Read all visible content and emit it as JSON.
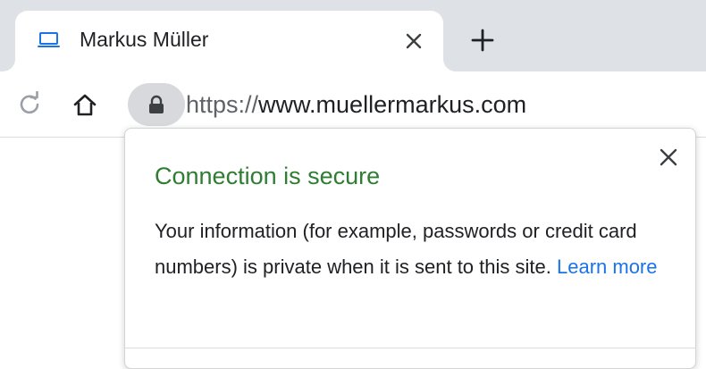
{
  "tab": {
    "title": "Markus Müller",
    "favicon": "laptop-icon",
    "close_icon": "close-icon"
  },
  "new_tab_icon": "plus-icon",
  "toolbar": {
    "reload_icon": "reload-icon",
    "home_icon": "home-icon",
    "lock_icon": "lock-icon",
    "url_scheme": "https://",
    "url_host": "www.muellermarkus.com"
  },
  "popup": {
    "title": "Connection is secure",
    "body": "Your information (for example, passwords or credit card numbers) is private when it is sent to this site.",
    "link": "Learn more",
    "close_icon": "close-icon"
  },
  "colors": {
    "tabstrip": "#dee1e6",
    "secure_green": "#2e7d32",
    "link_blue": "#1a73e8",
    "favicon_blue": "#1a73e8",
    "lock_chip": "#d8d9dc"
  }
}
